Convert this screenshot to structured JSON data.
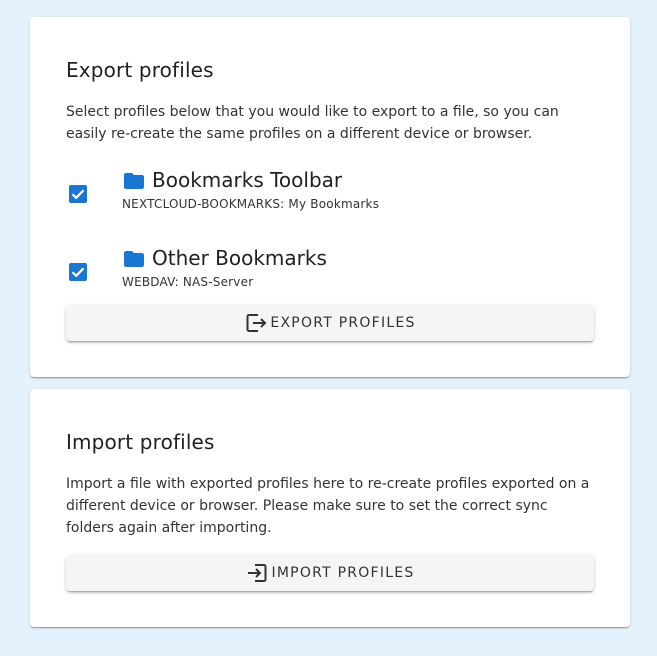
{
  "export": {
    "title": "Export profiles",
    "description": "Select profiles below that you would like to export to a file, so you can easily re-create the same profiles on a different device or browser.",
    "profiles": [
      {
        "name": "Bookmarks Toolbar",
        "subtitle": "NEXTCLOUD-BOOKMARKS: My Bookmarks",
        "checked": true,
        "icon": "folder-icon"
      },
      {
        "name": "Other Bookmarks",
        "subtitle": "WEBDAV: NAS-Server",
        "checked": true,
        "icon": "folder-icon"
      }
    ],
    "button_label": "EXPORT PROFILES",
    "button_icon": "export-icon"
  },
  "import": {
    "title": "Import profiles",
    "description": "Import a file with exported profiles here to re-create profiles exported on a different device or browser. Please make sure to set the correct sync folders again after importing.",
    "button_label": "IMPORT PROFILES",
    "button_icon": "import-icon"
  },
  "colors": {
    "background": "#e3f2fd",
    "accent": "#1976d2",
    "card": "#ffffff",
    "button": "#f5f5f5"
  }
}
